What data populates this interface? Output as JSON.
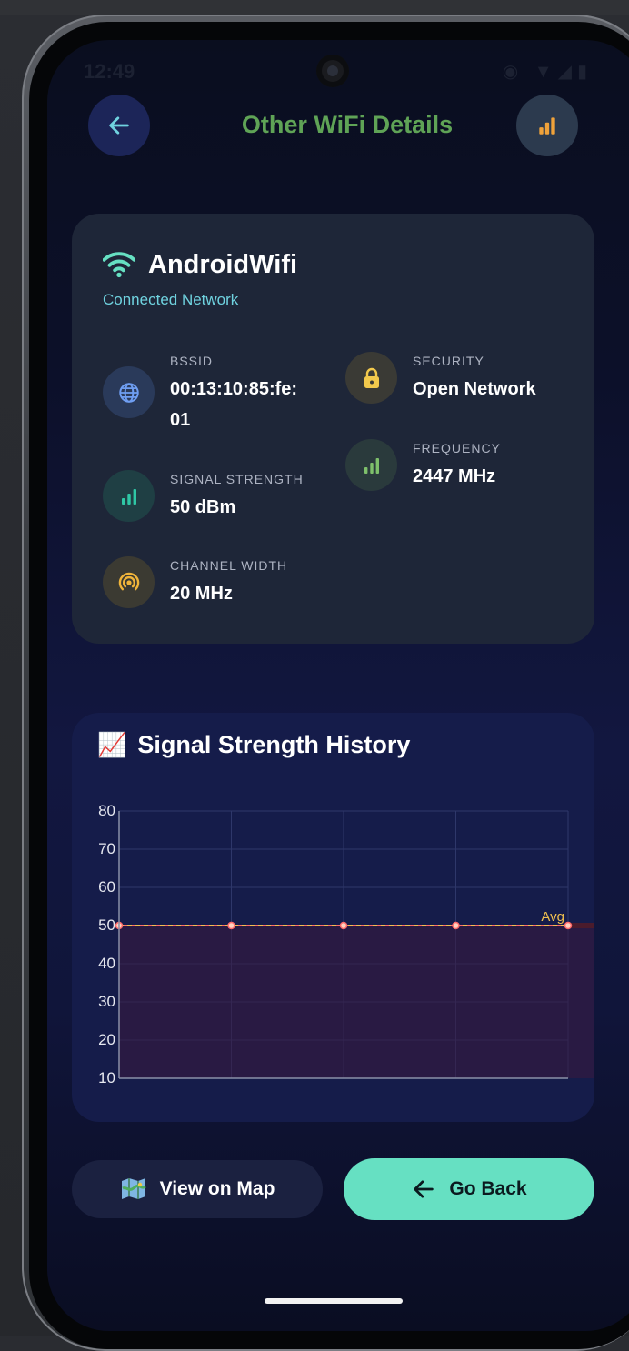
{
  "status_bar": {
    "time": "12:49",
    "icons": "◉ ▼◢▮"
  },
  "header": {
    "title": "Other WiFi Details",
    "title_color": "#5fa356",
    "back_icon": "arrow-left-icon",
    "signal_icon": "signal-bars-icon"
  },
  "network": {
    "name": "AndroidWifi",
    "subtitle": "Connected Network",
    "icon": "wifi-icon",
    "details": {
      "bssid": {
        "label": "BSSID",
        "value": "00:13:10:85:fe:\n01",
        "icon": "globe-icon"
      },
      "security": {
        "label": "SECURITY",
        "value": "Open Network",
        "icon": "lock-icon"
      },
      "frequency": {
        "label": "FREQUENCY",
        "value": "2447 MHz",
        "icon": "signal-bars-icon"
      },
      "signal_strength": {
        "label": "SIGNAL STRENGTH",
        "value": "50 dBm",
        "icon": "signal-bars-icon"
      },
      "channel_width": {
        "label": "CHANNEL WIDTH",
        "value": "20 MHz",
        "icon": "broadcast-icon"
      }
    }
  },
  "chart_section": {
    "title": "Signal Strength History",
    "emoji": "📈"
  },
  "chart_data": {
    "type": "line",
    "title": "Signal Strength History",
    "x": [
      1,
      2,
      3,
      4,
      5
    ],
    "series": [
      {
        "values": [
          50,
          50,
          50,
          50,
          50
        ],
        "color": "#ff6b6b"
      }
    ],
    "average": {
      "label": "Avg",
      "value": 50,
      "color": "#f1c04f"
    },
    "y_ticks": [
      80,
      70,
      60,
      50,
      40,
      30,
      20,
      10
    ],
    "ylim": [
      10,
      80
    ],
    "xlabel": "",
    "ylabel": "",
    "grid": true,
    "area_fill": true
  },
  "actions": {
    "view_map": {
      "label": "View on Map",
      "icon": "map-icon"
    },
    "go_back": {
      "label": "Go Back",
      "icon": "arrow-left-icon"
    }
  },
  "colors": {
    "accent": "#66e0c2",
    "card_bg": "#1e2638",
    "subtitle": "#6fd2df",
    "signal_orange": "#f0a23a",
    "signal_green": "#2fc7a5",
    "lock_yellow": "#f2c94c"
  }
}
